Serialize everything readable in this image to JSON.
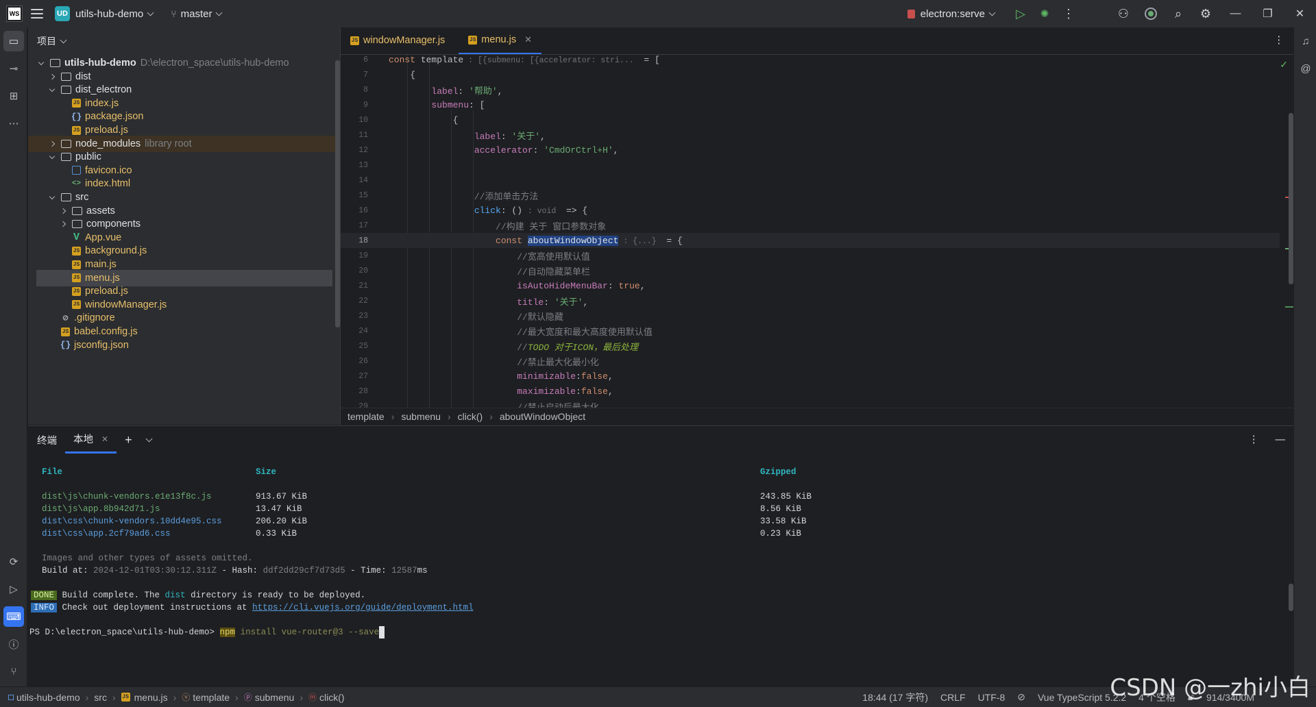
{
  "titlebar": {
    "logo": "WS",
    "project_badge": "UD",
    "project_name": "utils-hub-demo",
    "branch": "master",
    "run_config": "electron:serve"
  },
  "project_panel": {
    "title": "项目",
    "tree": [
      {
        "label": "utils-hub-demo",
        "extra": "D:\\electron_space\\utils-hub-demo",
        "type": "folder",
        "depth": 0,
        "open": true
      },
      {
        "label": "dist",
        "type": "folder",
        "depth": 1,
        "open": false
      },
      {
        "label": "dist_electron",
        "type": "folder",
        "depth": 1,
        "open": true
      },
      {
        "label": "index.js",
        "type": "js",
        "depth": 2
      },
      {
        "label": "package.json",
        "type": "json",
        "depth": 2
      },
      {
        "label": "preload.js",
        "type": "js",
        "depth": 2
      },
      {
        "label": "node_modules",
        "extra": "library root",
        "type": "folder",
        "depth": 1,
        "open": false,
        "lib": true
      },
      {
        "label": "public",
        "type": "folder",
        "depth": 1,
        "open": true
      },
      {
        "label": "favicon.ico",
        "type": "ico",
        "depth": 2
      },
      {
        "label": "index.html",
        "type": "html",
        "depth": 2
      },
      {
        "label": "src",
        "type": "folder",
        "depth": 1,
        "open": true
      },
      {
        "label": "assets",
        "type": "folder",
        "depth": 2,
        "open": false
      },
      {
        "label": "components",
        "type": "folder",
        "depth": 2,
        "open": false
      },
      {
        "label": "App.vue",
        "type": "vue",
        "depth": 2
      },
      {
        "label": "background.js",
        "type": "js",
        "depth": 2
      },
      {
        "label": "main.js",
        "type": "js",
        "depth": 2
      },
      {
        "label": "menu.js",
        "type": "js",
        "depth": 2,
        "selected": true
      },
      {
        "label": "preload.js",
        "type": "js",
        "depth": 2
      },
      {
        "label": "windowManager.js",
        "type": "js",
        "depth": 2
      },
      {
        "label": ".gitignore",
        "type": "git",
        "depth": 1
      },
      {
        "label": "babel.config.js",
        "type": "js",
        "depth": 1
      },
      {
        "label": "jsconfig.json",
        "type": "json",
        "depth": 1
      }
    ]
  },
  "editor": {
    "tabs": [
      {
        "label": "windowManager.js",
        "active": false
      },
      {
        "label": "menu.js",
        "active": true
      }
    ],
    "breadcrumb": [
      "template",
      "submenu",
      "click()",
      "aboutWindowObject"
    ]
  },
  "terminal": {
    "title": "终端",
    "tab": "本地",
    "headers": {
      "file": "File",
      "size": "Size",
      "gzipped": "Gzipped"
    },
    "rows": [
      {
        "file": "dist\\js\\chunk-vendors.e1e13f8c.js",
        "size": "913.67 KiB",
        "gzipped": "243.85 KiB",
        "kind": "js"
      },
      {
        "file": "dist\\js\\app.8b942d71.js",
        "size": "13.47 KiB",
        "gzipped": "8.56 KiB",
        "kind": "js"
      },
      {
        "file": "dist\\css\\chunk-vendors.10dd4e95.css",
        "size": "206.20 KiB",
        "gzipped": "33.58 KiB",
        "kind": "css"
      },
      {
        "file": "dist\\css\\app.2cf79ad6.css",
        "size": "0.33 KiB",
        "gzipped": "0.23 KiB",
        "kind": "css"
      }
    ],
    "omitted": "Images and other types of assets omitted.",
    "build_at_label": "Build at: ",
    "build_at": "2024-12-01T03:30:12.311Z",
    "hash_label": " - Hash: ",
    "hash": "ddf2dd29cf7d73d5",
    "time_label": " - Time: ",
    "time": "12587",
    "time_unit": "ms",
    "done_badge": "DONE",
    "done_pre": " Build complete. The ",
    "done_dist": "dist",
    "done_post": " directory is ready to be deployed.",
    "info_badge": "INFO",
    "info_text": " Check out deployment instructions at ",
    "info_link": "https://cli.vuejs.org/guide/deployment.html",
    "prompt": "PS D:\\electron_space\\utils-hub-demo> ",
    "cmd_npm": "npm",
    "cmd_rest": " install vue-router@3 --save"
  },
  "statusbar": {
    "path": [
      "utils-hub-demo",
      "src",
      "menu.js",
      "template",
      "submenu",
      "click()"
    ],
    "position": "18:44 (17 字符)",
    "line_sep": "CRLF",
    "encoding": "UTF-8",
    "language": "Vue TypeScript 5.2.2",
    "indent": "4 个空格",
    "memory": "914/3400M"
  },
  "watermark": "CSDN @一zhi小白",
  "colors": {
    "accent": "#3574f0",
    "bg": "#1e1f22",
    "panel": "#2b2d30"
  }
}
